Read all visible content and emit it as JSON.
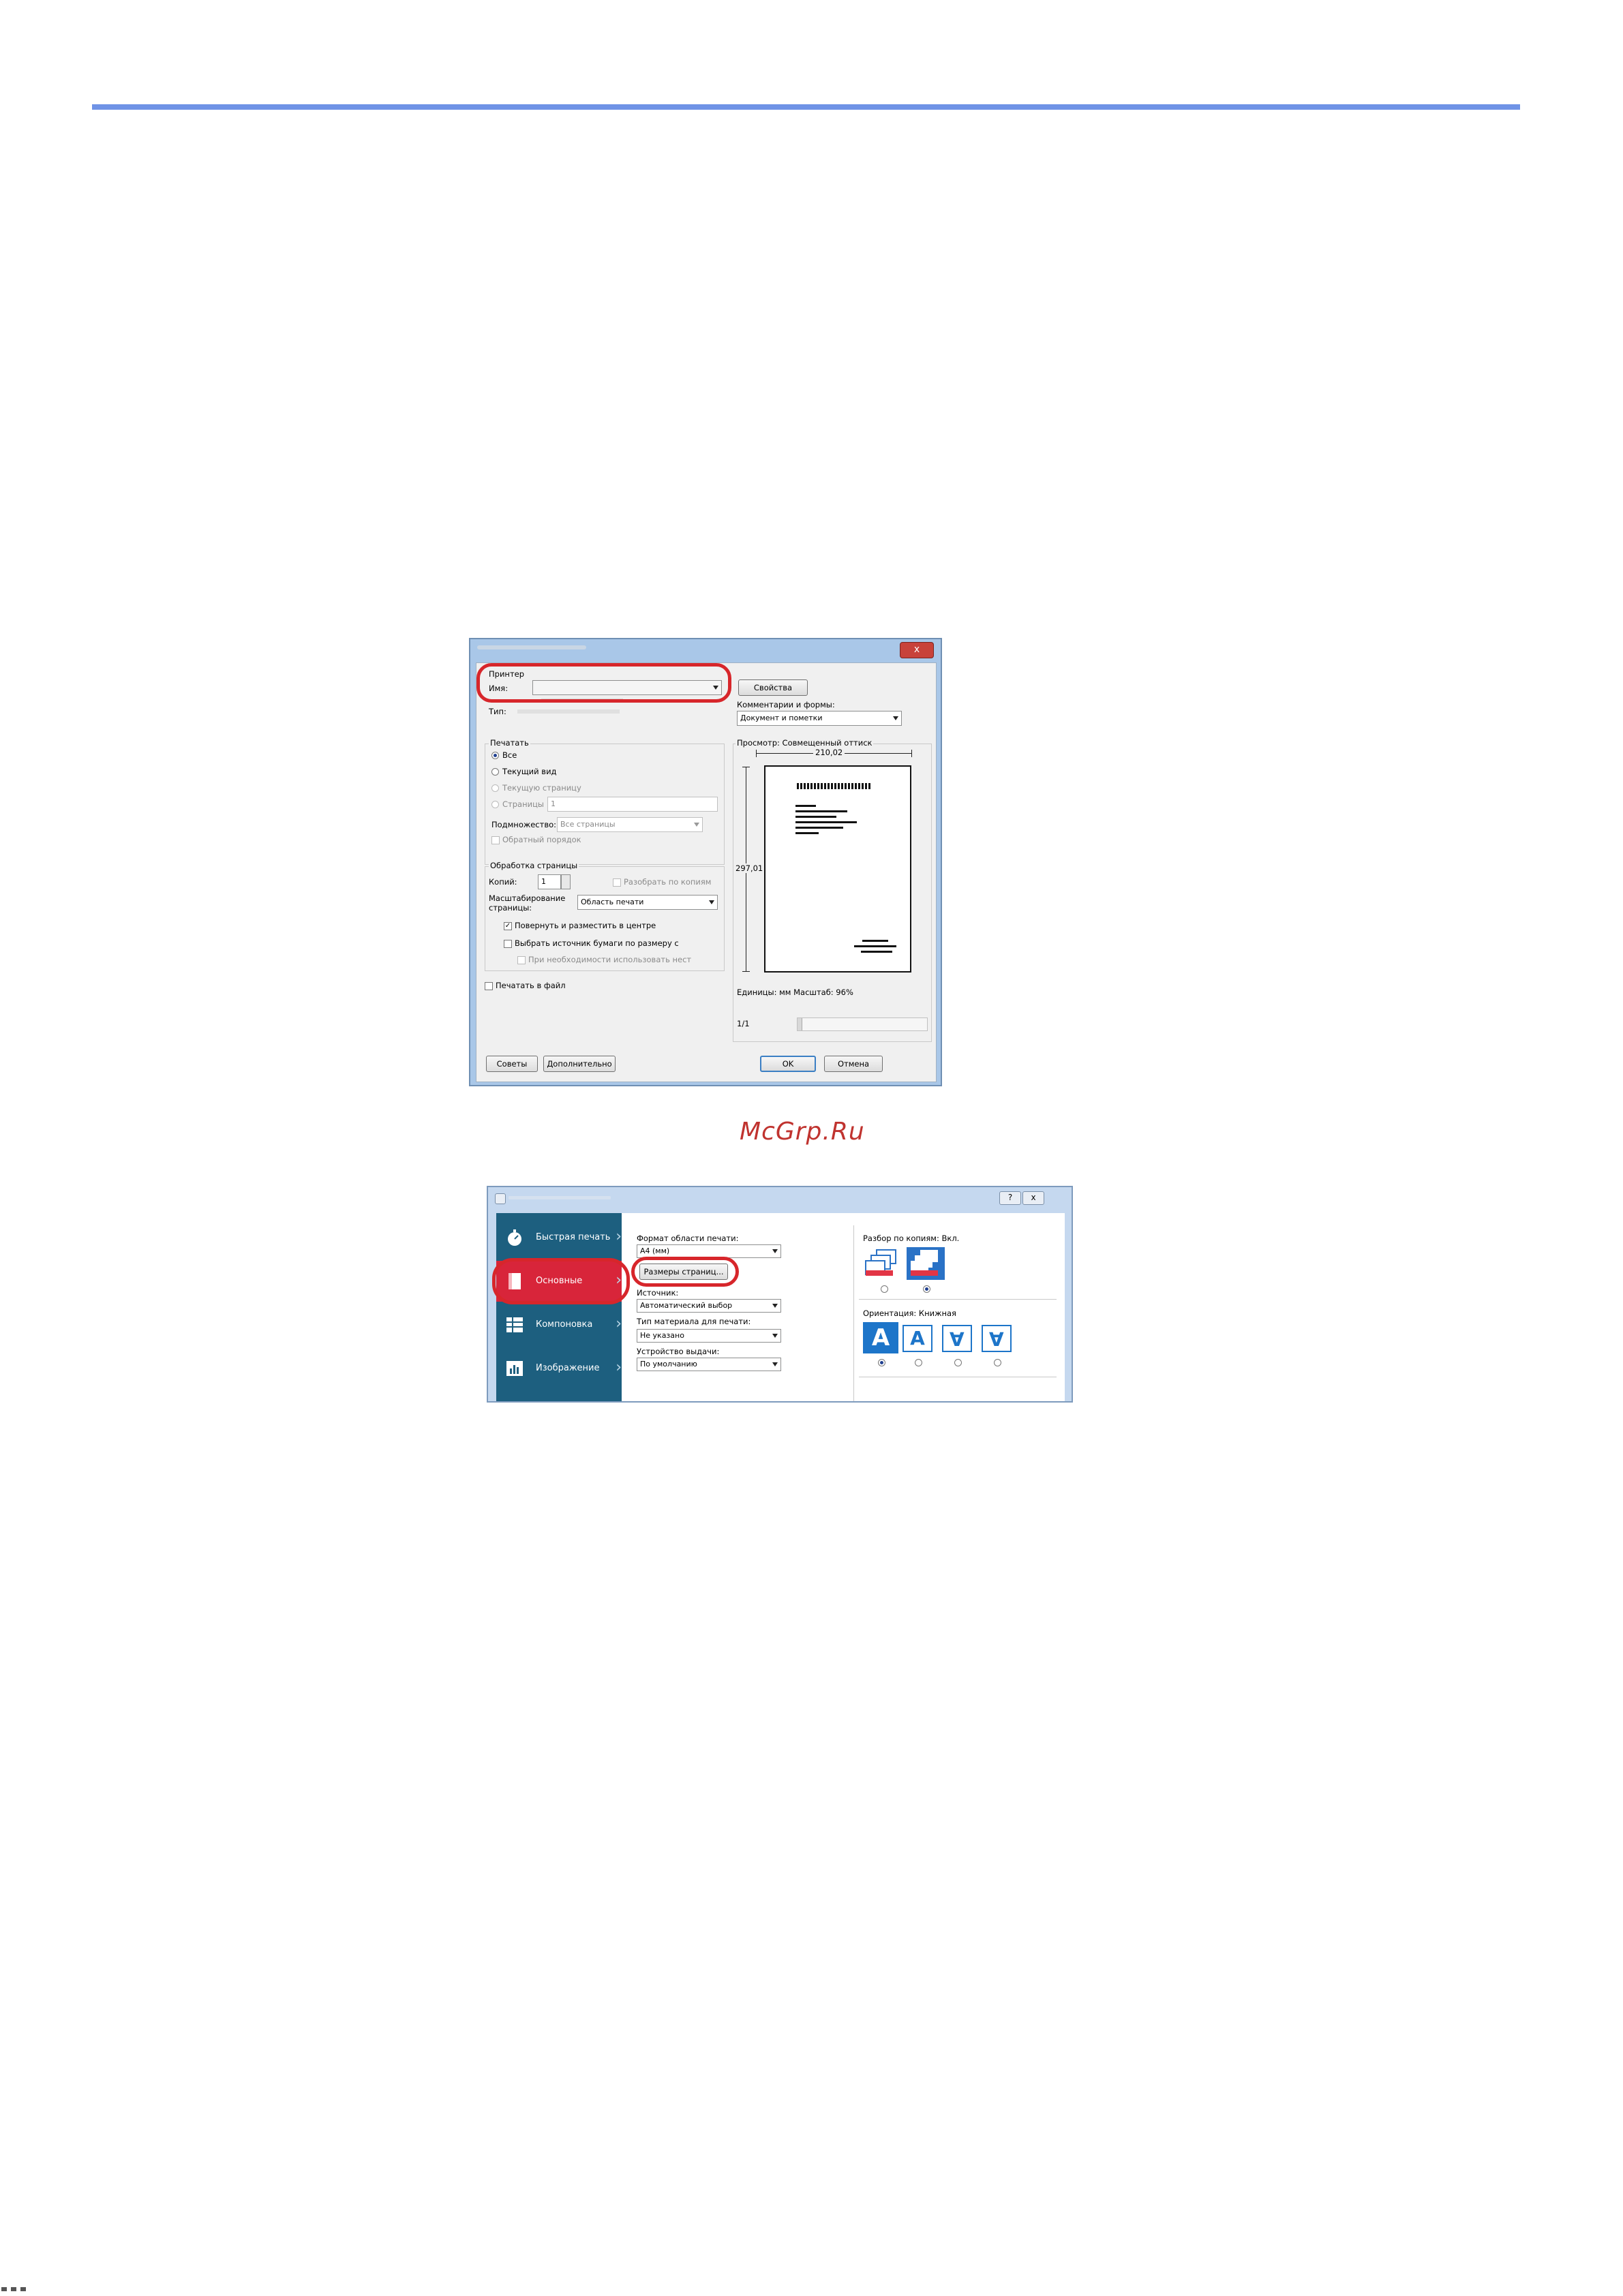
{
  "watermark": "McGrp.Ru",
  "dialog1": {
    "close_label": "x",
    "printer_group": "Принтер",
    "name_label": "Имя:",
    "type_label": "Тип:",
    "properties_button": "Свойства",
    "comments_label": "Комментарии и формы:",
    "comments_value": "Документ и пометки",
    "print_group": "Печатать",
    "opt_all": "Все",
    "opt_current_view": "Текущий вид",
    "opt_current_page": "Текущую страницу",
    "opt_pages": "Страницы",
    "pages_value": "1",
    "subset_label": "Подмножество:",
    "subset_value": "Все страницы",
    "reverse_order": "Обратный порядок",
    "page_handling_group": "Обработка страницы",
    "copies_label": "Копий:",
    "copies_value": "1",
    "collate_label": "Разобрать по копиям",
    "scaling_label_1": "Масштабирование",
    "scaling_label_2": "страницы:",
    "scaling_value": "Область печати",
    "rotate_center": "Повернуть и разместить в центре",
    "choose_source": "Выбрать источник бумаги по размеру с",
    "use_as_needed": "При необходимости использовать нест",
    "print_to_file": "Печатать в файл",
    "preview_label": "Просмотр: Совмещенный оттиск",
    "width_value": "210,02",
    "height_value": "297,01",
    "units_label": "Единицы: мм Масштаб: 96%",
    "page_counter": "1/1",
    "tips_button": "Советы",
    "advanced_button": "Дополнительно",
    "ok_button": "OK",
    "cancel_button": "Отмена"
  },
  "dialog2": {
    "help_label": "?",
    "close_label": "x",
    "sidebar": [
      {
        "label": "Быстрая печать",
        "icon": "stopwatch-icon"
      },
      {
        "label": "Основные",
        "icon": "document-icon"
      },
      {
        "label": "Компоновка",
        "icon": "layout-grid-icon"
      },
      {
        "label": "Изображение",
        "icon": "image-icon"
      }
    ],
    "print_size_label": "Формат области печати:",
    "print_size_value": "A4 (мм)",
    "page_sizes_button": "Размеры страниц...",
    "source_label": "Источник:",
    "source_value": "Автоматический выбор",
    "media_type_label": "Тип материала для печати:",
    "media_type_value": "Не указано",
    "output_label": "Устройство выдачи:",
    "output_value": "По умолчанию",
    "collate_label": "Разбор по копиям:",
    "collate_value": "Вкл.",
    "orientation_label": "Ориентация:",
    "orientation_value": "Книжная",
    "orientation_glyph": "A"
  }
}
